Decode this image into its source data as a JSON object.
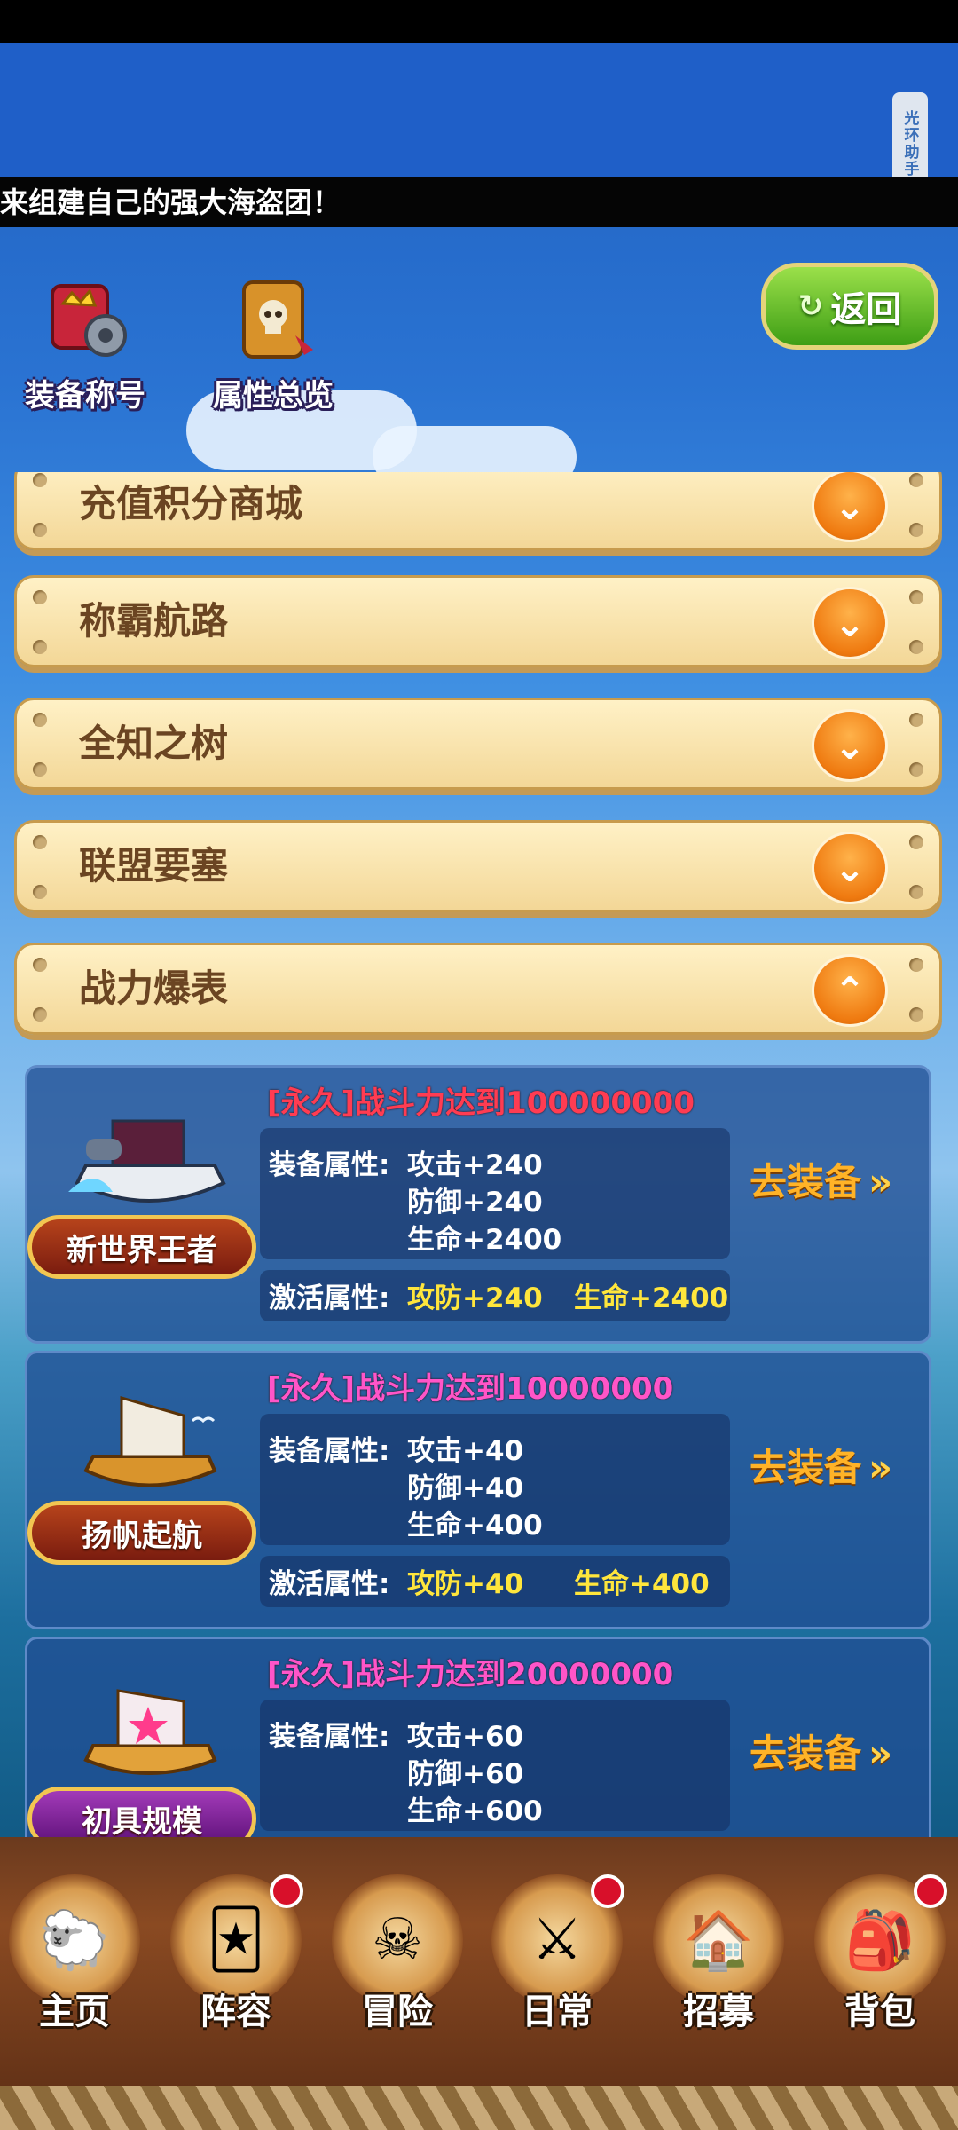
{
  "status_bar": {},
  "helper": {
    "label": "光环助手"
  },
  "marquee": {
    "text": "来组建自己的强大海盗团！"
  },
  "top_buttons": [
    {
      "label": "装备称号",
      "icon": "equip-title-icon"
    },
    {
      "label": "属性总览",
      "icon": "attribute-book-icon"
    }
  ],
  "back_button": {
    "label": "返回"
  },
  "categories": [
    {
      "label": "充值积分商城",
      "expanded": false
    },
    {
      "label": "称霸航路",
      "expanded": false
    },
    {
      "label": "全知之树",
      "expanded": false
    },
    {
      "label": "联盟要塞",
      "expanded": false
    },
    {
      "label": "战力爆表",
      "expanded": true
    }
  ],
  "titles": [
    {
      "requirement": "[永久]战斗力达到100000000",
      "badge": "新世界王者",
      "equip_label": "装备属性:",
      "stats": [
        "攻击+240",
        "防御+240",
        "生命+2400"
      ],
      "activate_label": "激活属性:",
      "activate_a": "攻防+240",
      "activate_b": "生命+2400",
      "action": "去装备"
    },
    {
      "requirement": "[永久]战斗力达到10000000",
      "badge": "扬帆起航",
      "equip_label": "装备属性:",
      "stats": [
        "攻击+40",
        "防御+40",
        "生命+400"
      ],
      "activate_label": "激活属性:",
      "activate_a": "攻防+40",
      "activate_b": "生命+400",
      "action": "去装备"
    },
    {
      "requirement": "[永久]战斗力达到20000000",
      "badge": "初具规模",
      "equip_label": "装备属性:",
      "stats": [
        "攻击+60",
        "防御+60",
        "生命+600"
      ],
      "action": "去装备"
    }
  ],
  "nav": [
    {
      "label": "主页",
      "icon": "home-icon",
      "badge": false
    },
    {
      "label": "阵容",
      "icon": "lineup-icon",
      "badge": true
    },
    {
      "label": "冒险",
      "icon": "adventure-icon",
      "badge": false
    },
    {
      "label": "日常",
      "icon": "daily-icon",
      "badge": true
    },
    {
      "label": "招募",
      "icon": "recruit-icon",
      "badge": false
    },
    {
      "label": "背包",
      "icon": "backpack-icon",
      "badge": true
    }
  ],
  "colors": {
    "accent_orange": "#ef7a10",
    "requirement_red": "#ff3c52",
    "requirement_pink": "#ff55c8",
    "activate_yellow": "#ffe63c"
  }
}
